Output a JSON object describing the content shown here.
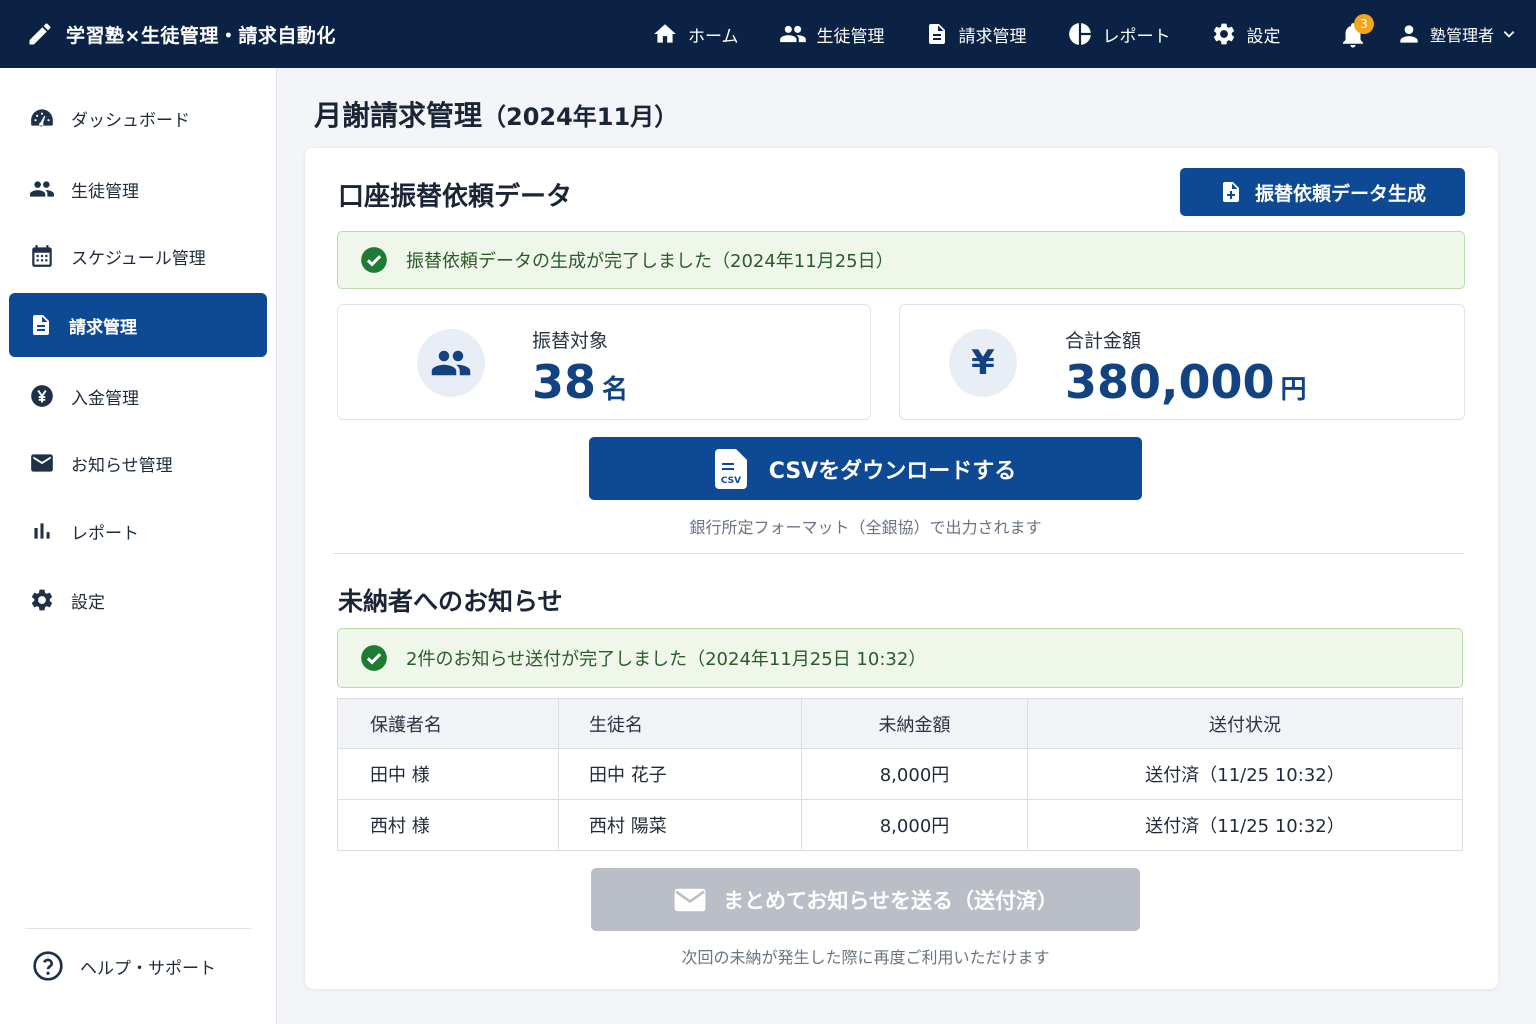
{
  "app": {
    "title": "学習塾×生徒管理・請求自動化"
  },
  "nav": [
    {
      "label": "ホーム",
      "icon": "home-icon"
    },
    {
      "label": "生徒管理",
      "icon": "people-icon"
    },
    {
      "label": "請求管理",
      "icon": "document-icon"
    },
    {
      "label": "レポート",
      "icon": "pie-chart-icon"
    },
    {
      "label": "設定",
      "icon": "gear-icon"
    }
  ],
  "notifications": {
    "count": "3"
  },
  "user": {
    "name": "塾管理者"
  },
  "sidebar": {
    "items": [
      {
        "label": "ダッシュボード",
        "icon": "dashboard-icon"
      },
      {
        "label": "生徒管理",
        "icon": "people-icon"
      },
      {
        "label": "スケジュール管理",
        "icon": "calendar-icon"
      },
      {
        "label": "請求管理",
        "icon": "document-icon",
        "active": true
      },
      {
        "label": "入金管理",
        "icon": "yen-icon"
      },
      {
        "label": "お知らせ管理",
        "icon": "mail-icon"
      },
      {
        "label": "レポート",
        "icon": "bar-chart-icon"
      },
      {
        "label": "設定",
        "icon": "gear-icon"
      }
    ],
    "help": "ヘルプ・サポート"
  },
  "page": {
    "title": "月謝請求管理",
    "period": "（2024年11月）"
  },
  "transfer": {
    "title": "口座振替依頼データ",
    "generate_button": "振替依頼データ生成",
    "success_message": "振替依頼データの生成が完了しました（2024年11月25日）",
    "target_label": "振替対象",
    "target_count": "38",
    "target_unit": "名",
    "total_label": "合計金額",
    "total_amount": "380,000",
    "total_unit": "円",
    "yen_symbol": "¥",
    "csv_button": "CSVをダウンロードする",
    "csv_badge": "CSV",
    "csv_note": "銀行所定フォーマット（全銀協）で出力されます"
  },
  "unpaid": {
    "title": "未納者へのお知らせ",
    "success_message": "2件のお知らせ送付が完了しました（2024年11月25日 10:32）",
    "columns": [
      "保護者名",
      "生徒名",
      "未納金額",
      "送付状況"
    ],
    "rows": [
      {
        "guardian": "田中 様",
        "student": "田中 花子",
        "amount": "8,000円",
        "status": "送付済（11/25 10:32）"
      },
      {
        "guardian": "西村 様",
        "student": "西村 陽菜",
        "amount": "8,000円",
        "status": "送付済（11/25 10:32）"
      }
    ],
    "bulk_button": "まとめてお知らせを送る（送付済）",
    "bulk_note": "次回の未納が発生した際に再度ご利用いただけます"
  },
  "colors": {
    "topbar": "#0b2244",
    "accent": "#0e4a94",
    "success": "#2e7d2e",
    "badge": "#f2a51e"
  }
}
